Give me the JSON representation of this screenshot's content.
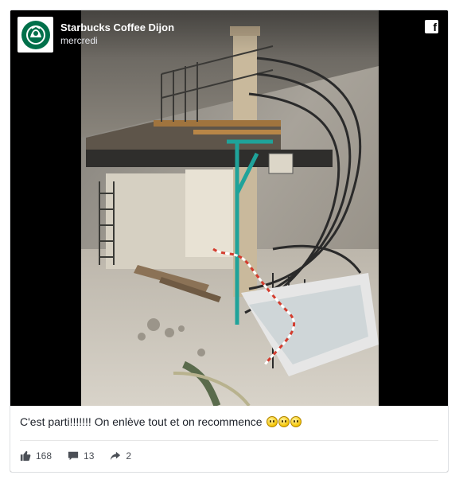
{
  "post": {
    "page_name": "Starbucks Coffee Dijon",
    "timestamp": "mercredi",
    "caption": "C'est parti!!!!!!! On enlève tout et on recommence",
    "caption_emojis": [
      "grinning-face-icon",
      "grinning-face-icon",
      "grinning-face-icon"
    ],
    "photo_description_icon": "construction-photo"
  },
  "icons": {
    "avatar": "starbucks-logo-icon",
    "network": "facebook-icon",
    "like": "thumbs-up-icon",
    "comment": "comment-icon",
    "share": "share-arrow-icon"
  },
  "stats": {
    "likes": "168",
    "comments": "13",
    "shares": "2"
  },
  "colors": {
    "brand_green": "#00704a",
    "card_border": "#dddfe2",
    "text": "#1d2129",
    "muted": "#4b4f56"
  }
}
